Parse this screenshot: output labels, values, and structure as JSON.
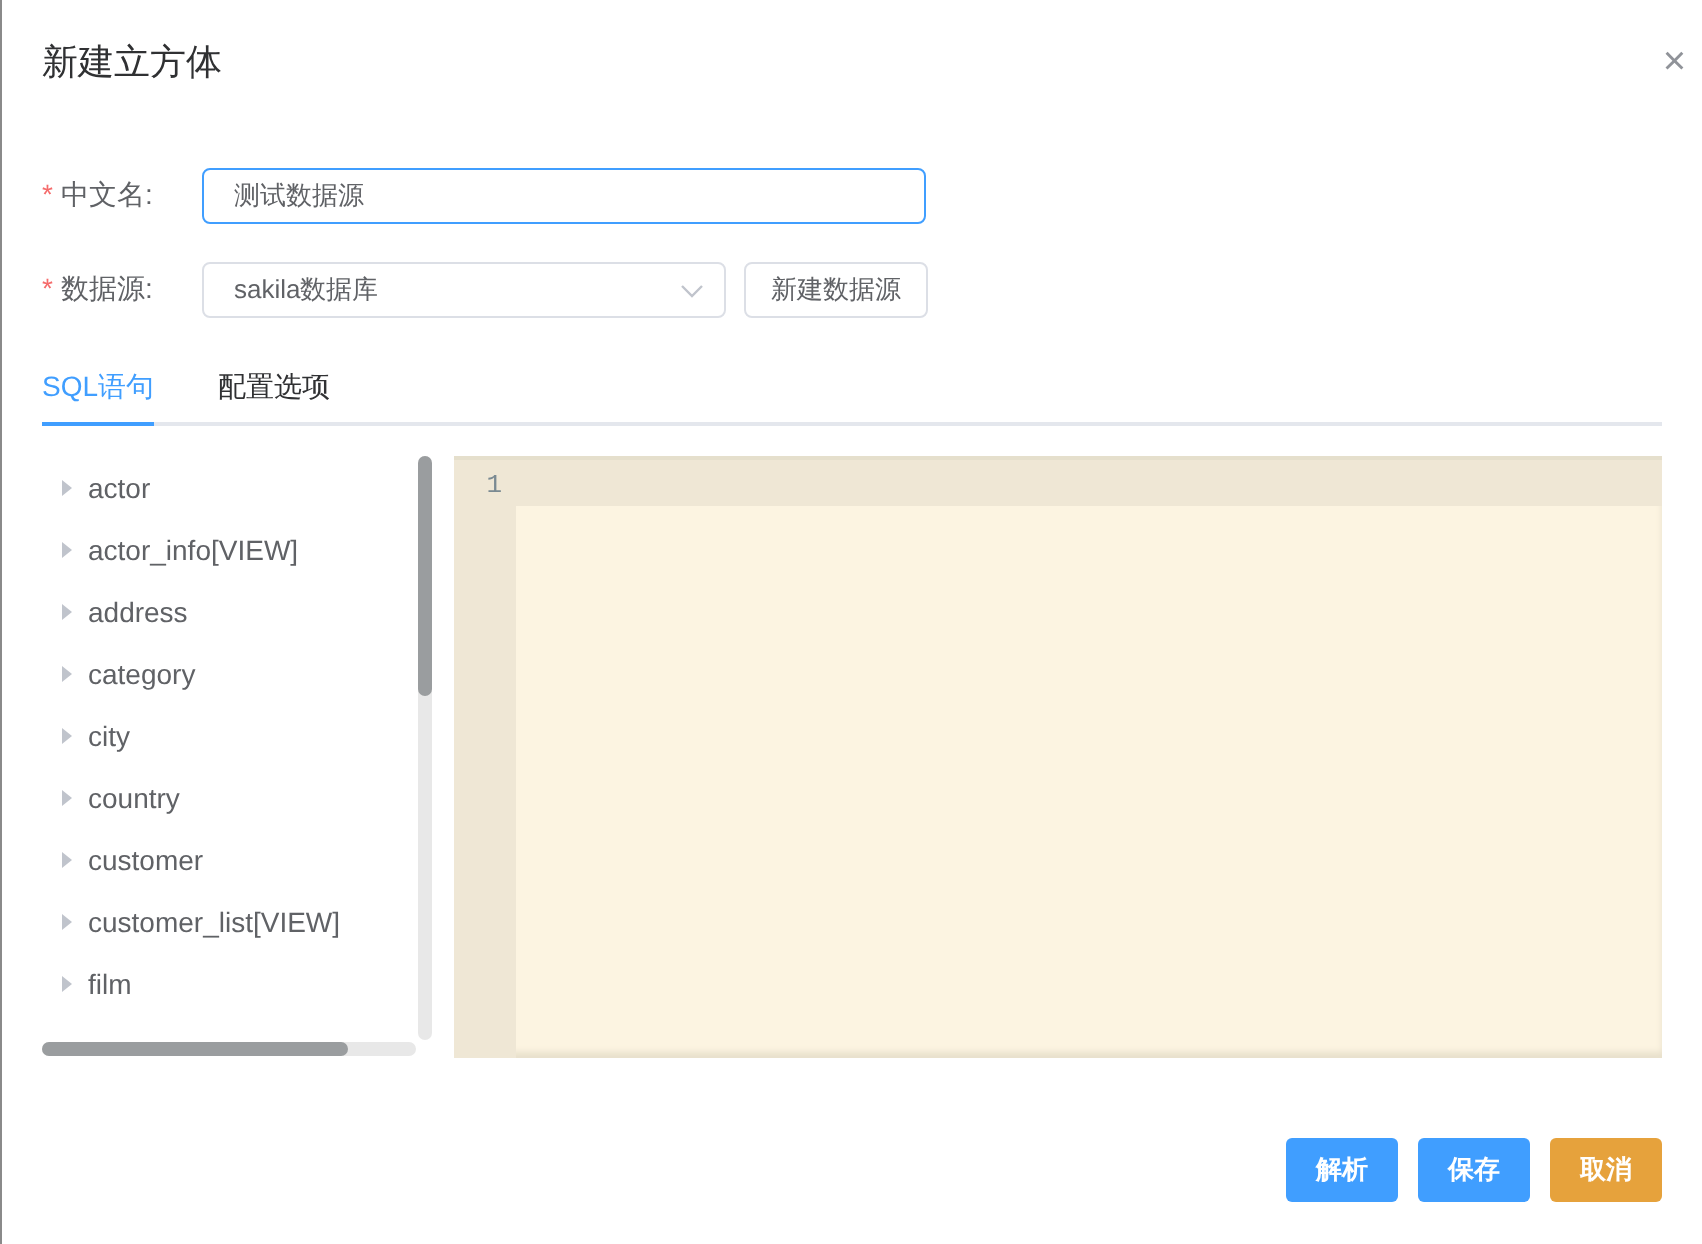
{
  "dialog": {
    "title": "新建立方体",
    "close": "×"
  },
  "form": [
    {
      "kind": "input",
      "required_mark": "*",
      "label": "中文名:",
      "value": "测试数据源",
      "focused": true
    },
    {
      "kind": "select",
      "required_mark": "*",
      "label": "数据源:",
      "value": "sakila数据库",
      "button": "新建数据源"
    }
  ],
  "tabs": [
    {
      "label": "SQL语句",
      "selected": true
    },
    {
      "label": "配置选项",
      "selected": false
    }
  ],
  "tree": {
    "items": [
      {
        "label": "actor"
      },
      {
        "label": "actor_info[VIEW]"
      },
      {
        "label": "address"
      },
      {
        "label": "category"
      },
      {
        "label": "city"
      },
      {
        "label": "country"
      },
      {
        "label": "customer"
      },
      {
        "label": "customer_list[VIEW]"
      },
      {
        "label": "film"
      }
    ]
  },
  "editor": {
    "line_numbers": [
      "1"
    ]
  },
  "buttons": [
    {
      "label": "解析",
      "kind": "primary"
    },
    {
      "label": "保存",
      "kind": "primary"
    },
    {
      "label": "取消",
      "kind": "warning"
    }
  ]
}
